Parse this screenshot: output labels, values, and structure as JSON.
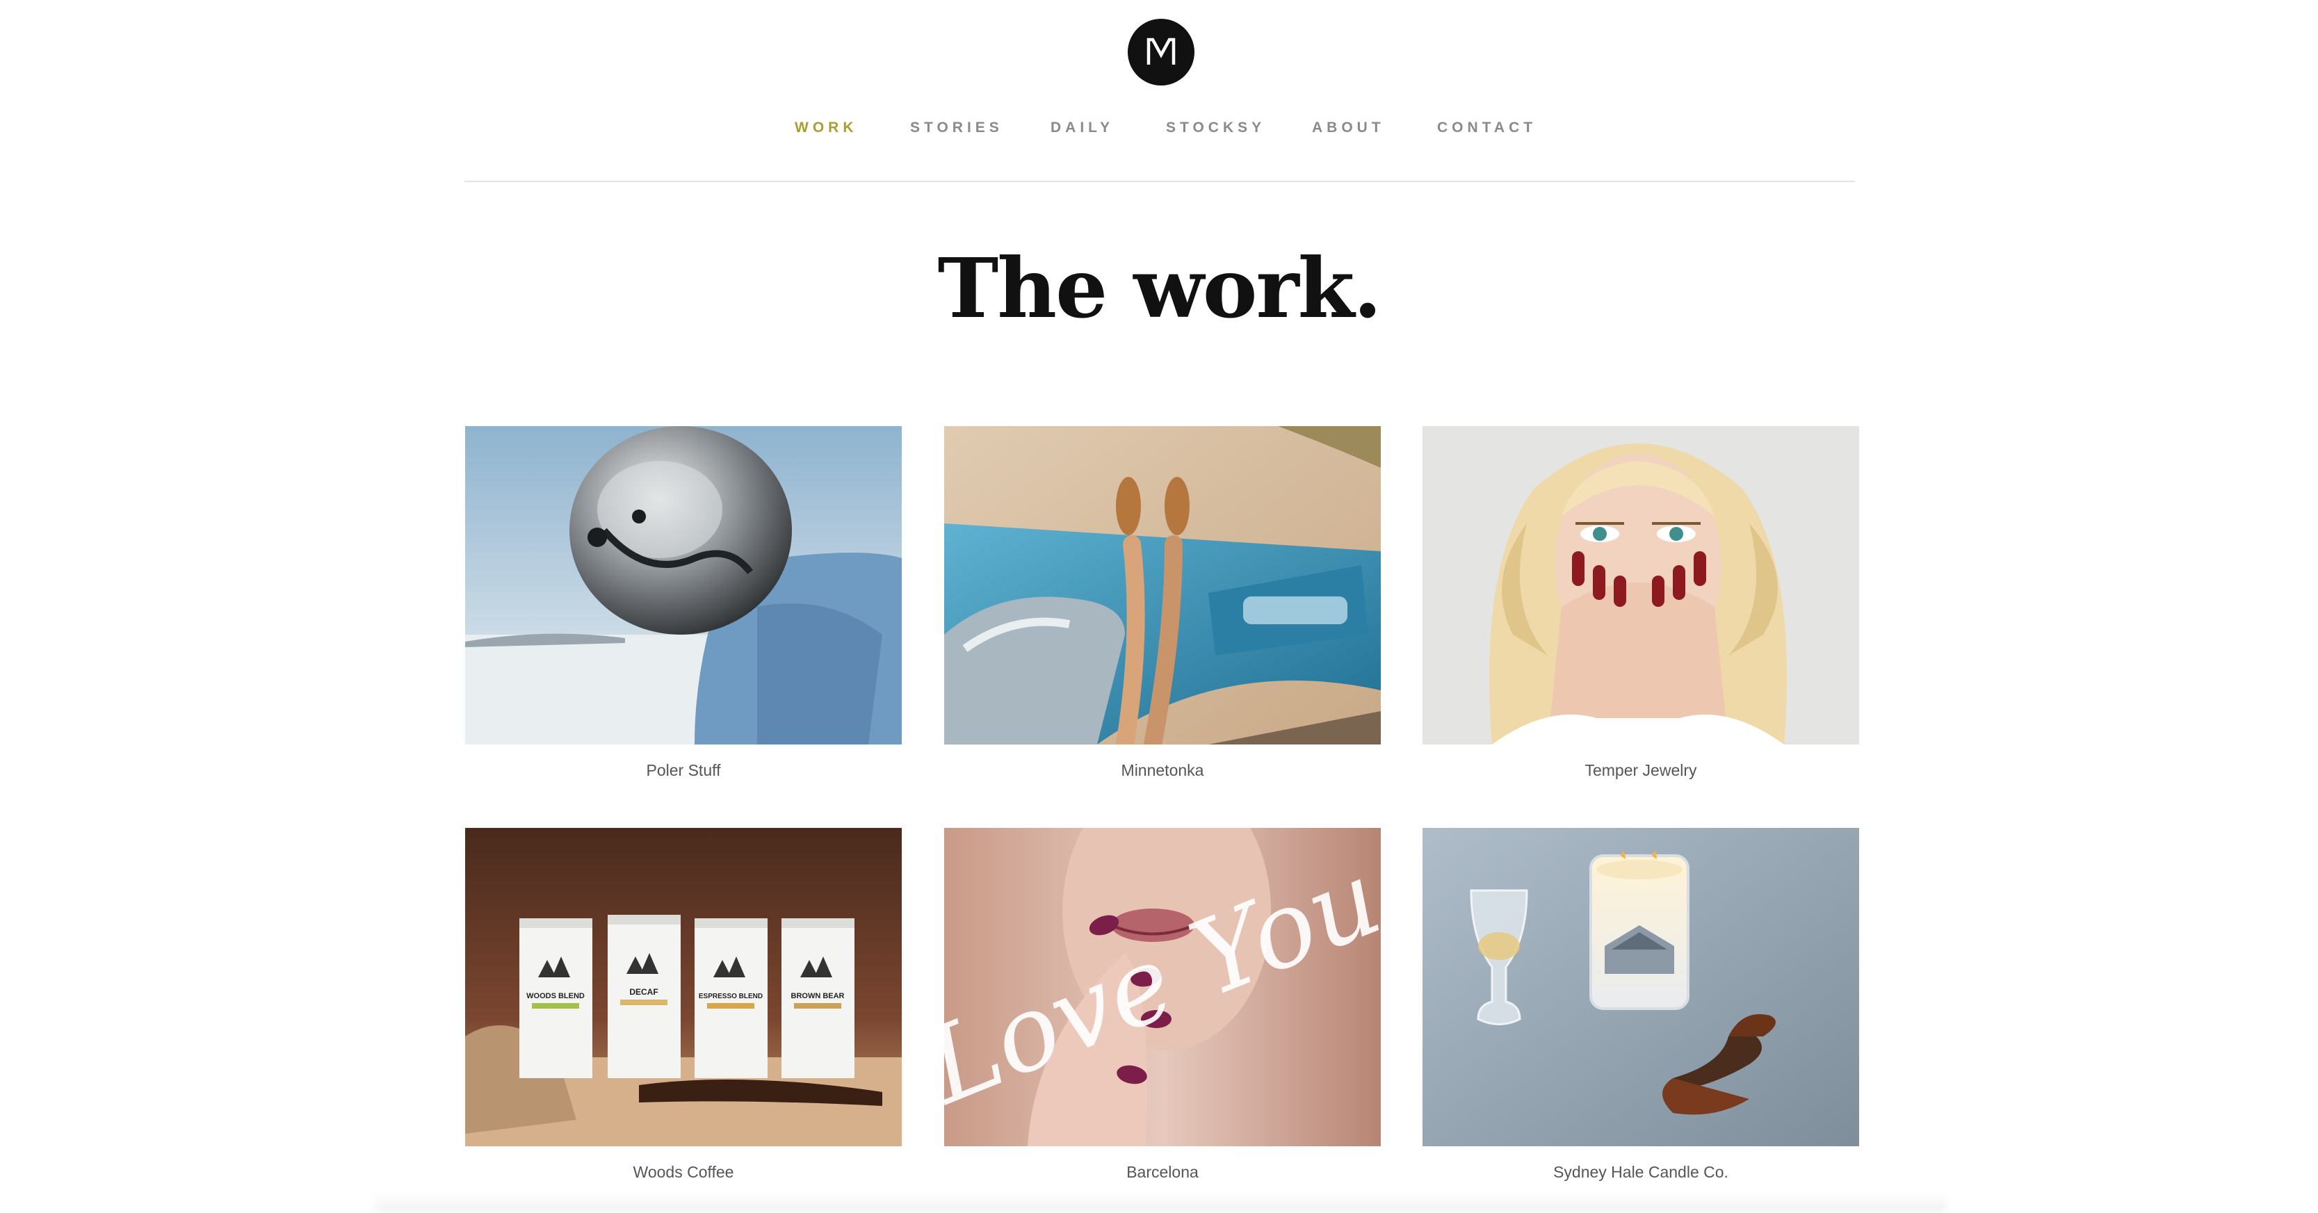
{
  "logo": {
    "letter": "M",
    "icon": "logo-m-circle"
  },
  "nav": {
    "items": [
      {
        "label": "WORK",
        "active": true
      },
      {
        "label": "STORIES",
        "active": false
      },
      {
        "label": "DAILY",
        "active": false
      },
      {
        "label": "STOCKSY",
        "active": false
      },
      {
        "label": "ABOUT",
        "active": false
      },
      {
        "label": "CONTACT",
        "active": false
      }
    ],
    "active_color": "#a99f2f",
    "color": "#8a8a8a"
  },
  "page": {
    "title": "The work."
  },
  "projects": [
    {
      "caption": "Poler Stuff",
      "image": "astronaut-helmet-photo"
    },
    {
      "caption": "Minnetonka",
      "image": "vintage-car-legs-photo"
    },
    {
      "caption": "Temper Jewelry",
      "image": "blonde-woman-red-nails-photo"
    },
    {
      "caption": "Woods Coffee",
      "image": "coffee-bags-photo"
    },
    {
      "caption": "Barcelona",
      "image": "love-you-lips-photo",
      "overlay_text": "Love You"
    },
    {
      "caption": "Sydney Hale Candle Co.",
      "image": "candle-pipe-glass-photo"
    }
  ],
  "coffee_bags": [
    "WOODS BLEND",
    "DECAF",
    "ESPRESSO BLEND",
    "BROWN BEAR"
  ]
}
